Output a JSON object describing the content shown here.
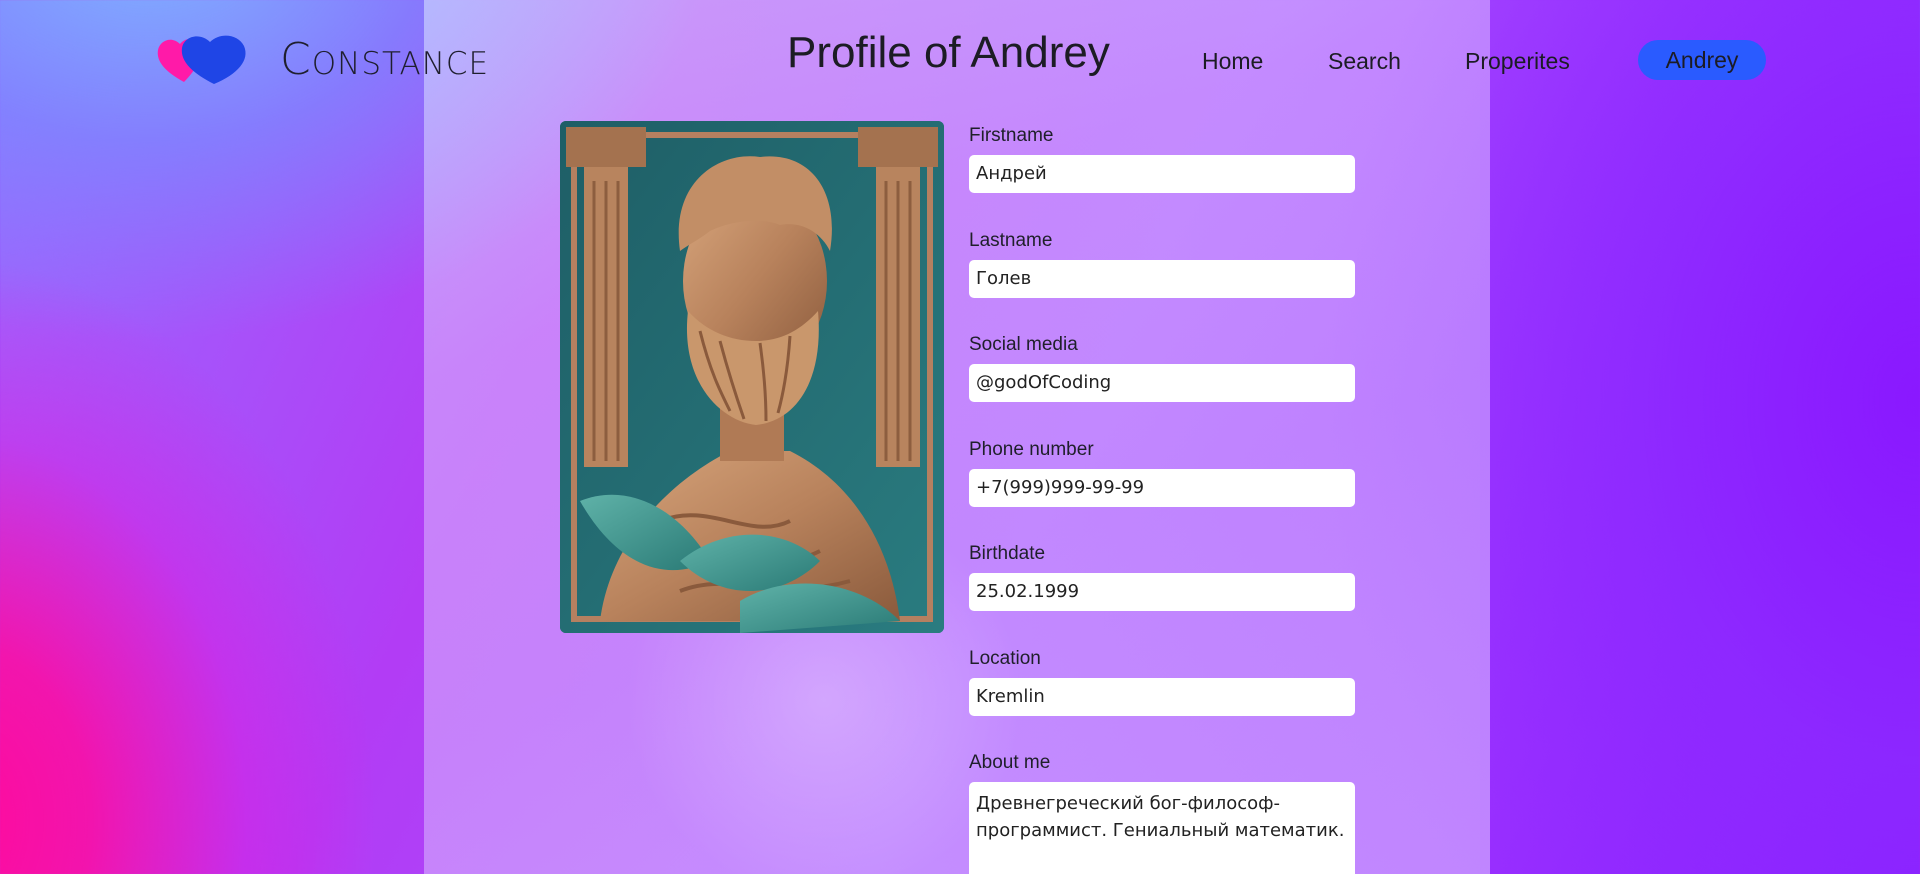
{
  "brand": {
    "name": "Constance"
  },
  "page": {
    "title": "Profile of Andrey"
  },
  "nav": {
    "home": "Home",
    "search": "Search",
    "properties": "Properites",
    "user": "Andrey"
  },
  "colors": {
    "accent": "#2a5bff",
    "logo_pink": "#ff1aa8",
    "logo_blue": "#1f45e6"
  },
  "avatar": {
    "icon": "greek-philosopher-bust-portrait"
  },
  "form": {
    "firstname": {
      "label": "Firstname",
      "value": "Андрей"
    },
    "lastname": {
      "label": "Lastname",
      "value": "Голев"
    },
    "social": {
      "label": "Social media",
      "value": "@godOfCoding"
    },
    "phone": {
      "label": "Phone number",
      "value": "+7(999)999-99-99"
    },
    "birthdate": {
      "label": "Birthdate",
      "value": "25.02.1999"
    },
    "location": {
      "label": "Location",
      "value": "Kremlin"
    },
    "about": {
      "label": "About me",
      "value": "Древнегреческий бог-философ-программист. Гениальный математик."
    }
  }
}
